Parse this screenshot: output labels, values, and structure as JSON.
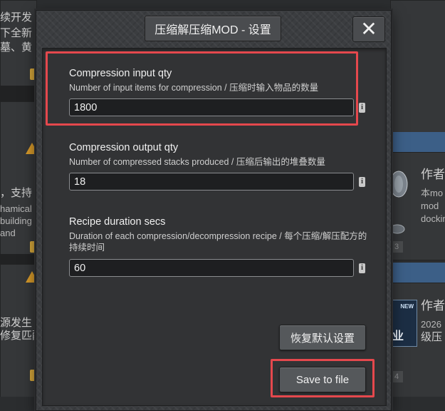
{
  "dialog": {
    "title": "压缩解压缩MOD - 设置",
    "close_glyph": "✕"
  },
  "settings": [
    {
      "name": "Compression input qty",
      "description": "Number of input items for compression / 压缩时输入物品的数量",
      "value": "1800"
    },
    {
      "name": "Compression output qty",
      "description": "Number of compressed stacks produced / 压缩后输出的堆叠数量",
      "value": "18"
    },
    {
      "name": "Recipe duration secs",
      "description": "Duration of each compression/decompression recipe / 每个压缩/解压配方的持续时间",
      "value": "60"
    }
  ],
  "info_icon_glyph": "i",
  "buttons": {
    "reset_defaults": "恢复默认设置",
    "save_to_file": "Save to file"
  },
  "background": {
    "left_texts": [
      "续开发",
      "下全新",
      "墓、黄",
      "，支持",
      "hamical",
      "building",
      "and",
      "源发生",
      "修复匹配"
    ],
    "right_texts": [
      "作者",
      "本mo",
      "mod",
      "dockin",
      "作者",
      "2026",
      "级压"
    ],
    "tags": [
      "3",
      "4"
    ],
    "new_badge": "NEW",
    "right_partial": "业"
  },
  "colors": {
    "highlight": "#e5484d",
    "warning": "#d79a2a",
    "accent_blue": "#3c5f87"
  }
}
